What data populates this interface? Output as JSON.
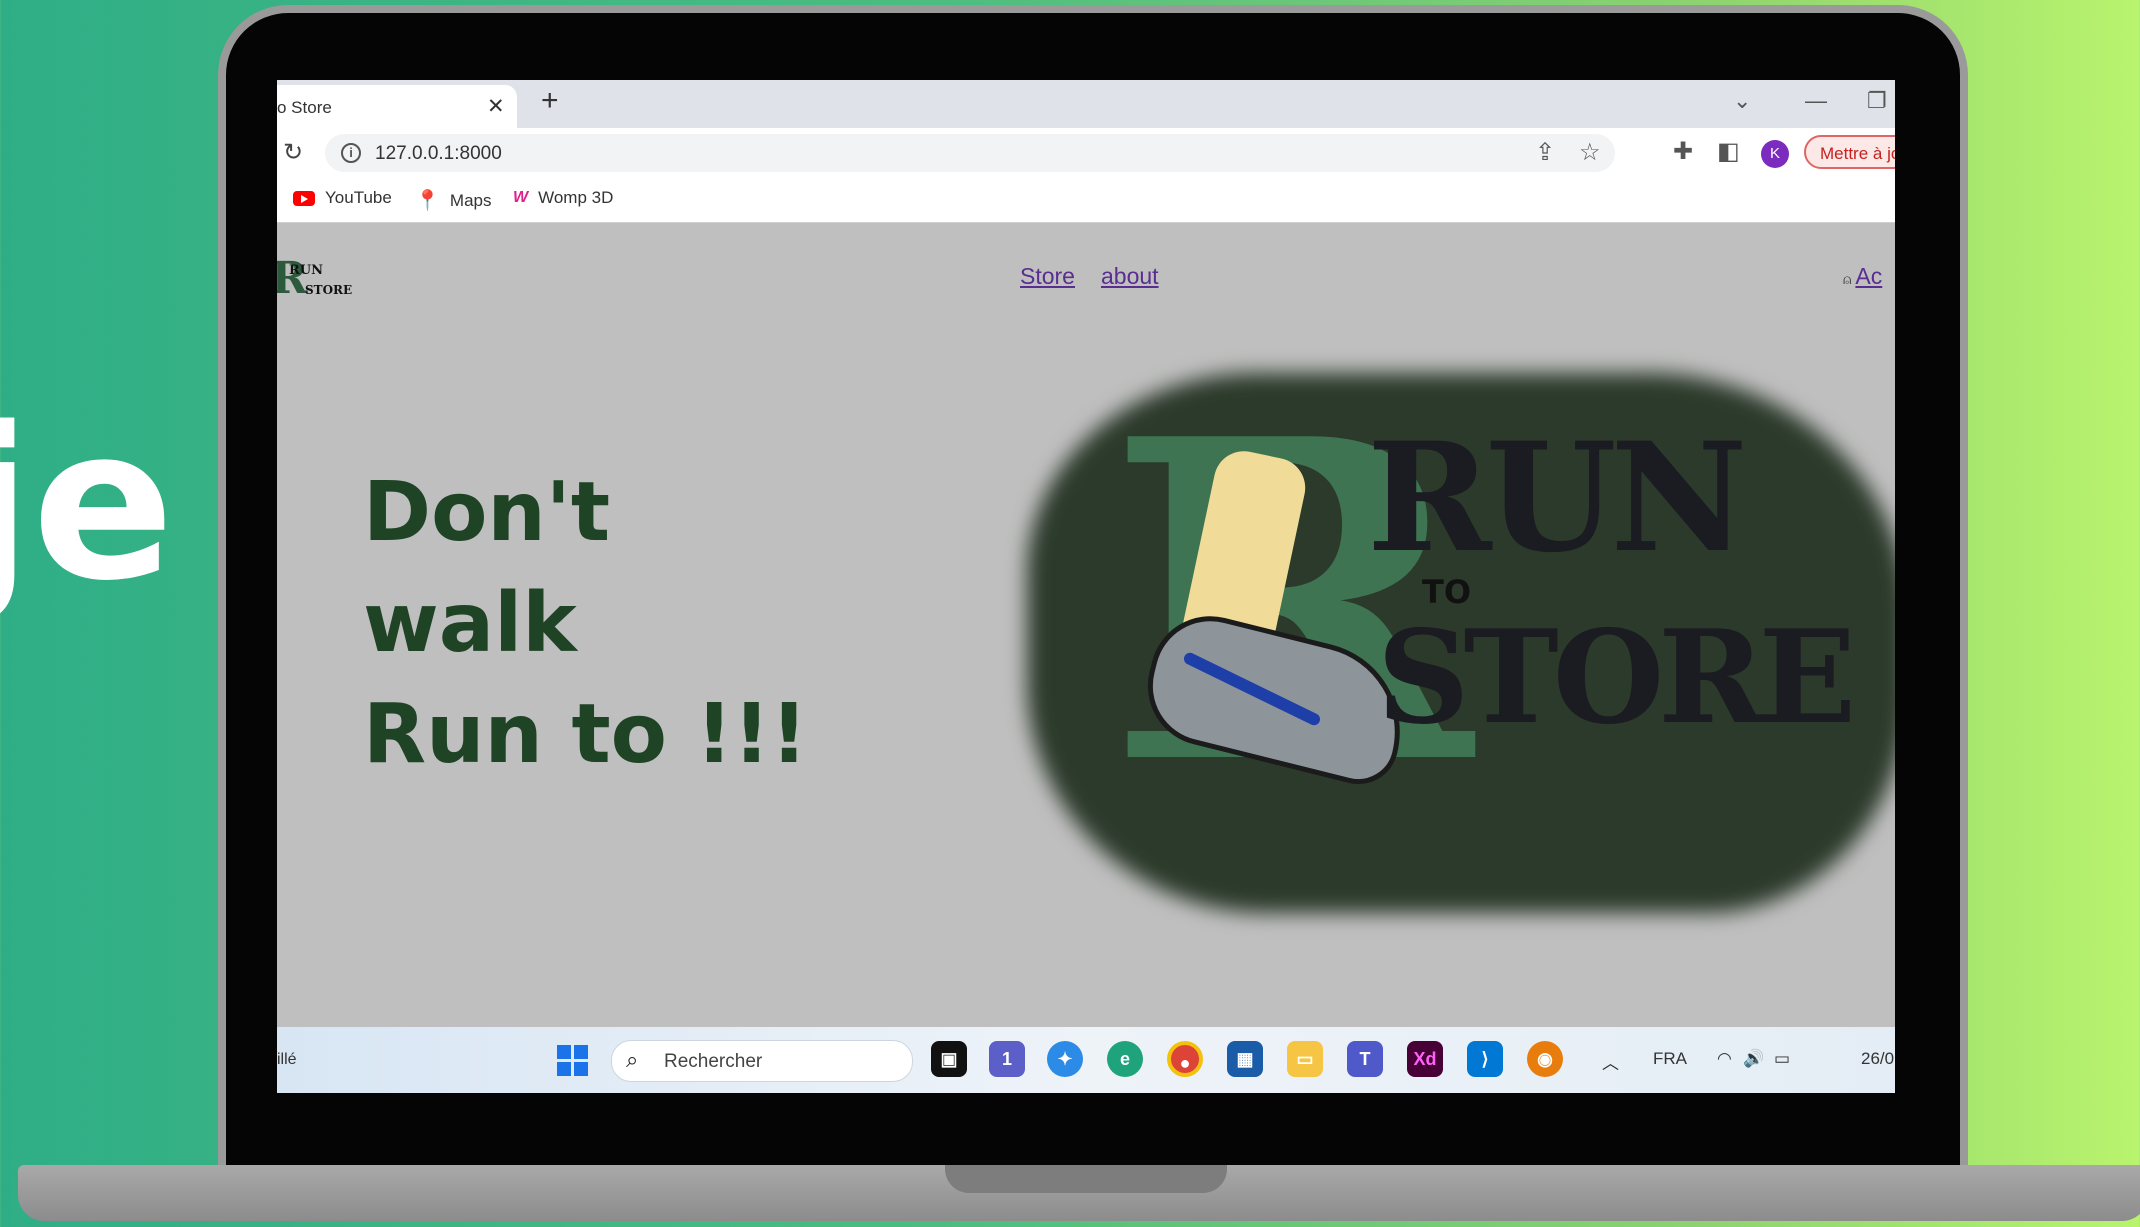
{
  "background_text": "je",
  "browser": {
    "tab_title": "o Store",
    "tab_close": "✕",
    "new_tab": "+",
    "url": "127.0.0.1:8000",
    "update_button": "Mettre à jour",
    "avatar_letter": "K",
    "bookmarks": [
      {
        "label": "YouTube",
        "icon": "youtube-icon"
      },
      {
        "label": "Maps",
        "icon": "maps-pin-icon"
      },
      {
        "label": "Womp 3D",
        "icon": "womp-icon"
      }
    ]
  },
  "site": {
    "logo_line1": "RUN",
    "logo_line2": "STORE",
    "logo_letter": "R",
    "nav": {
      "store": "Store",
      "about": "about",
      "account": "Ac"
    },
    "headline": [
      "Don't",
      "walk",
      "Run to !!!"
    ],
    "hero_logo": {
      "letter": "R",
      "word1": "RUN",
      "word2": "TO",
      "word3": "STORE"
    }
  },
  "taskbar": {
    "left_text": "illé",
    "search_placeholder": "Rechercher",
    "language": "FRA",
    "date_partial": "26/0",
    "notification_badge": "1"
  }
}
